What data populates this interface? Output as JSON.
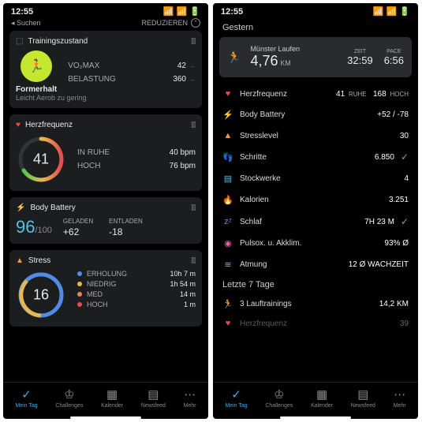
{
  "statusbar": {
    "time": "12:55",
    "back": "◂ Suchen",
    "reduce": "REDUZIEREN"
  },
  "left": {
    "training": {
      "title": "Trainingszustand",
      "status": "Formerhalt",
      "sub": "Leicht Aerob zu gering",
      "vo2label": "VO₂MAX",
      "vo2": "42",
      "loadLabel": "BELASTUNG",
      "load": "360"
    },
    "hr": {
      "title": "Herzfrequenz",
      "value": "41",
      "restLabel": "IN RUHE",
      "rest": "40 bpm",
      "highLabel": "HOCH",
      "high": "76 bpm"
    },
    "bb": {
      "title": "Body Battery",
      "value": "96",
      "max": "/100",
      "chargedLabel": "GELADEN",
      "charged": "+62",
      "drainedLabel": "ENTLADEN",
      "drained": "-18"
    },
    "stress": {
      "title": "Stress",
      "value": "16",
      "rows": [
        {
          "c": "#4f8ce8",
          "l": "ERHOLUNG",
          "v": "10h 7 m"
        },
        {
          "c": "#e8b84c",
          "l": "NIEDRIG",
          "v": "1h 54 m"
        },
        {
          "c": "#e8844c",
          "l": "MED",
          "v": "14 m"
        },
        {
          "c": "#e84c4c",
          "l": "HOCH",
          "v": "1 m"
        }
      ]
    }
  },
  "right": {
    "yesterday": "Gestern",
    "activity": {
      "name": "Münster Laufen",
      "dist": "4,76",
      "distU": "KM",
      "timeL": "ZEIT",
      "time": "32:59",
      "paceL": "PACE",
      "pace": "6:56"
    },
    "metrics": [
      {
        "icon": "♥",
        "cls": "heart",
        "name": "Herzfrequenz",
        "val": "41",
        "sub": "RUHE",
        "val2": "168",
        "sub2": "HOCH"
      },
      {
        "icon": "⚡",
        "cls": "teal",
        "name": "Body Battery",
        "val": "+52 / -78"
      },
      {
        "icon": "▲",
        "cls": "orange",
        "name": "Stresslevel",
        "val": "30"
      },
      {
        "icon": "👣",
        "cls": "blue-i",
        "name": "Schritte",
        "val": "6.850",
        "check": true
      },
      {
        "icon": "▤",
        "cls": "teal",
        "name": "Stockwerke",
        "val": "4"
      },
      {
        "icon": "🔥",
        "cls": "green-i",
        "name": "Kalorien",
        "val": "3.251"
      },
      {
        "icon": "zᶻ",
        "cls": "purple",
        "name": "Schlaf",
        "val": "7H 23 M",
        "check": true
      },
      {
        "icon": "◉",
        "cls": "pink",
        "name": "Pulsox. u. Akklim.",
        "val": "93% Ø"
      },
      {
        "icon": "≋",
        "cls": "teal",
        "name": "Atmung",
        "val": "12 Ø WACHZEIT"
      }
    ],
    "week": {
      "title": "Letzte 7 Tage",
      "runs": "3 Lauftrainings",
      "dist": "14,2 KM",
      "cut": "39"
    }
  },
  "tabs": [
    {
      "icon": "✓",
      "label": "Mein Tag",
      "active": true
    },
    {
      "icon": "♔",
      "label": "Challenges"
    },
    {
      "icon": "▦",
      "label": "Kalender"
    },
    {
      "icon": "▤",
      "label": "Newsfeed"
    },
    {
      "icon": "⋯",
      "label": "Mehr"
    }
  ]
}
